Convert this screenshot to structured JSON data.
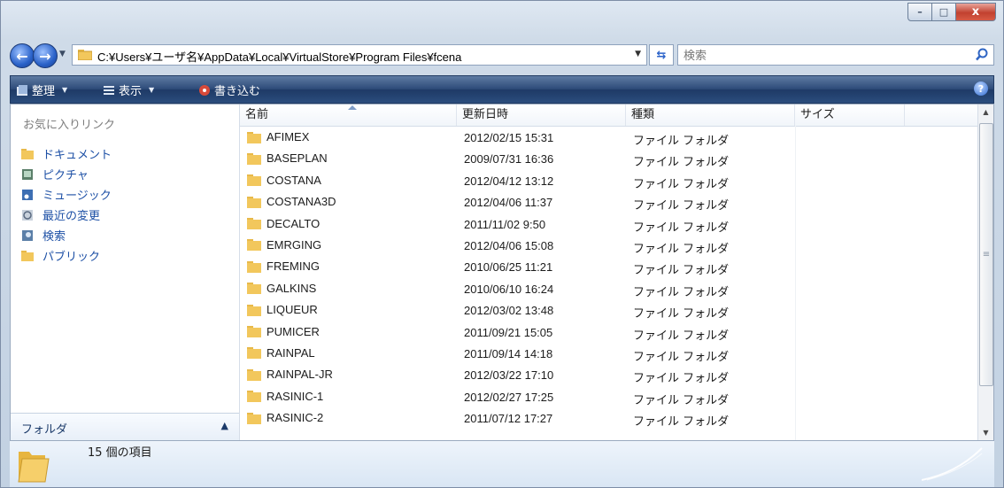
{
  "window": {
    "caption_buttons": {
      "minimize": "–",
      "maximize": "□",
      "close": "x"
    }
  },
  "address": {
    "path": "C:¥Users¥ユーザ名¥AppData¥Local¥VirtualStore¥Program Files¥fcena",
    "search_placeholder": "検索"
  },
  "toolbar": {
    "organize": "整理",
    "views": "表示",
    "burn": "書き込む"
  },
  "nav_pane": {
    "favorites_title": "お気に入りリンク",
    "items": [
      {
        "label": "ドキュメント",
        "icon": "folder-icon"
      },
      {
        "label": "ピクチャ",
        "icon": "pictures-icon"
      },
      {
        "label": "ミュージック",
        "icon": "music-icon"
      },
      {
        "label": "最近の変更",
        "icon": "recent-changes-icon"
      },
      {
        "label": "検索",
        "icon": "search-icon"
      },
      {
        "label": "パブリック",
        "icon": "folder-icon"
      }
    ],
    "folders_label": "フォルダ"
  },
  "file_list": {
    "columns": {
      "name": "名前",
      "modified": "更新日時",
      "type": "種類",
      "size": "サイズ"
    },
    "rows": [
      {
        "name": "AFIMEX",
        "modified": "2012/02/15 15:31",
        "type": "ファイル フォルダ"
      },
      {
        "name": "BASEPLAN",
        "modified": "2009/07/31 16:36",
        "type": "ファイル フォルダ"
      },
      {
        "name": "COSTANA",
        "modified": "2012/04/12 13:12",
        "type": "ファイル フォルダ"
      },
      {
        "name": "COSTANA3D",
        "modified": "2012/04/06 11:37",
        "type": "ファイル フォルダ"
      },
      {
        "name": "DECALTO",
        "modified": "2011/11/02 9:50",
        "type": "ファイル フォルダ"
      },
      {
        "name": "EMRGING",
        "modified": "2012/04/06 15:08",
        "type": "ファイル フォルダ"
      },
      {
        "name": "FREMING",
        "modified": "2010/06/25 11:21",
        "type": "ファイル フォルダ"
      },
      {
        "name": "GALKINS",
        "modified": "2010/06/10 16:24",
        "type": "ファイル フォルダ"
      },
      {
        "name": "LIQUEUR",
        "modified": "2012/03/02 13:48",
        "type": "ファイル フォルダ"
      },
      {
        "name": "PUMICER",
        "modified": "2011/09/21 15:05",
        "type": "ファイル フォルダ"
      },
      {
        "name": "RAINPAL",
        "modified": "2011/09/14 14:18",
        "type": "ファイル フォルダ"
      },
      {
        "name": "RAINPAL-JR",
        "modified": "2012/03/22 17:10",
        "type": "ファイル フォルダ"
      },
      {
        "name": "RASINIC-1",
        "modified": "2012/02/27 17:25",
        "type": "ファイル フォルダ"
      },
      {
        "name": "RASINIC-2",
        "modified": "2011/07/12 17:27",
        "type": "ファイル フォルダ"
      }
    ]
  },
  "status": {
    "item_count": "15 個の項目"
  }
}
